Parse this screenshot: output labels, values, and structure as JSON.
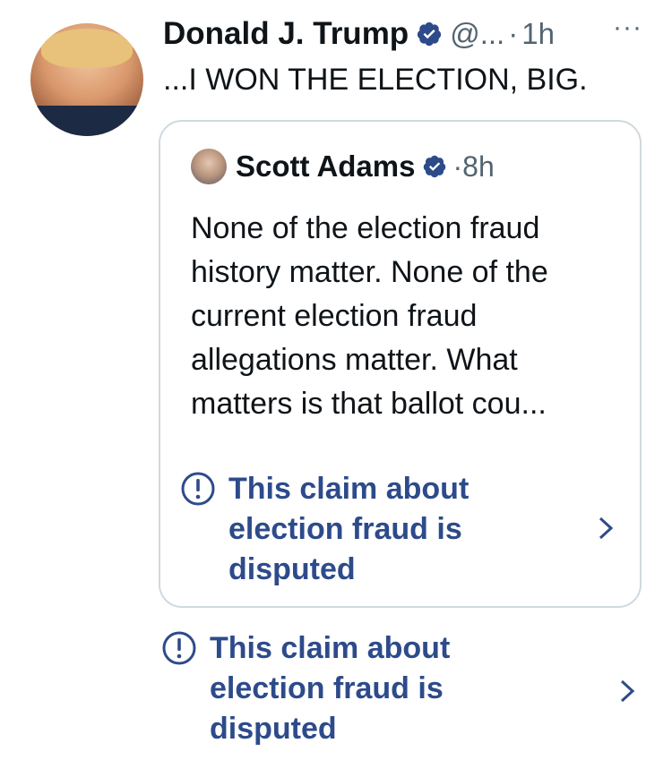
{
  "tweet": {
    "author_name": "Donald J. Trump",
    "handle": "@...",
    "separator": "·",
    "time": "1h",
    "more": "···",
    "text": "...I WON THE ELECTION, BIG."
  },
  "quoted_tweet": {
    "author_name": "Scott Adams",
    "separator": "·",
    "time": "8h",
    "text": "None of the election fraud history matter. None of the current election fraud allegations matter. What matters is that ballot cou...",
    "notice": "This claim about election fraud is disputed"
  },
  "outer_notice": "This claim about election fraud is disputed",
  "colors": {
    "verified": "#1d9bf0",
    "notice": "#2d4a8a",
    "secondary_text": "#536471",
    "border": "#cfd9de"
  },
  "icons": [
    "verified-badge-icon",
    "more-icon",
    "exclamation-icon",
    "chevron-right-icon"
  ]
}
